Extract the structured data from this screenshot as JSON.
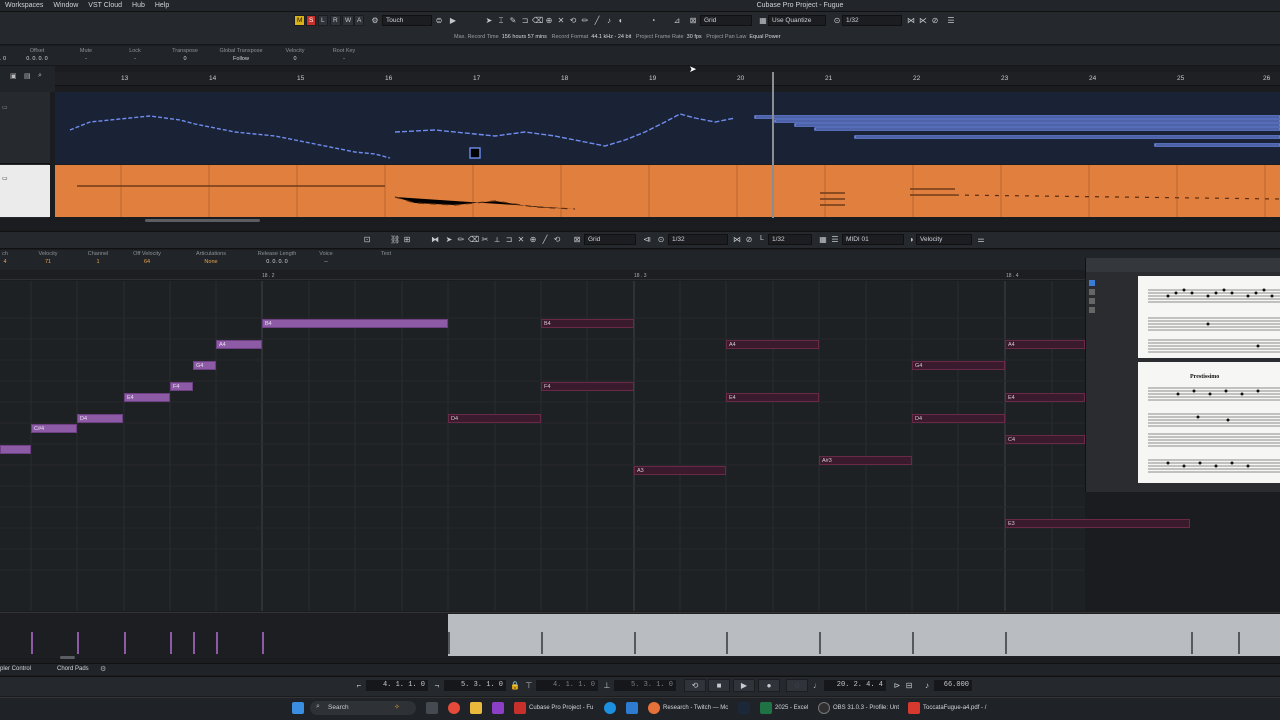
{
  "menu": [
    "Workspaces",
    "Window",
    "VST Cloud",
    "Hub",
    "Help"
  ],
  "window_title": "Cubase Pro Project - Fugue",
  "toolbar": {
    "state_buttons": [
      "M",
      "S",
      "L",
      "R",
      "W",
      "A"
    ],
    "automation_mode": "Touch",
    "snap_type": "Grid",
    "quantize_mode": "Use Quantize",
    "quantize_value": "1/32"
  },
  "status": {
    "max_record_time_label": "Max. Record Time",
    "max_record_time": "156 hours 57 mins",
    "record_format_label": "Record Format",
    "record_format": "44.1 kHz - 24 bit",
    "frame_rate_label": "Project Frame Rate",
    "frame_rate": "30 fps",
    "pan_law_label": "Project Pan Law",
    "pan_law": "Equal Power"
  },
  "infoline": [
    {
      "label": "Offset",
      "value": "0. 0. 0. 0"
    },
    {
      "label": "Mute",
      "value": "-"
    },
    {
      "label": "Lock",
      "value": "-"
    },
    {
      "label": "Transpose",
      "value": "0"
    },
    {
      "label": "Global Transpose",
      "value": "Follow"
    },
    {
      "label": "Velocity",
      "value": "0"
    },
    {
      "label": "Root Key",
      "value": "-"
    }
  ],
  "infoline_leading": ". 0",
  "ruler_bars": [
    "13",
    "14",
    "15",
    "16",
    "17",
    "18",
    "19",
    "20",
    "21",
    "22",
    "23",
    "24",
    "25",
    "26"
  ],
  "editor_toolbar": {
    "snap_type": "Grid",
    "quantize_value": "1/32",
    "length_label": "L",
    "length_value": "1/32",
    "midi_channel": "MIDI 01",
    "controller": "Velocity"
  },
  "editor_info": [
    {
      "label": "ch",
      "value": "4"
    },
    {
      "label": "Velocity",
      "value": "71"
    },
    {
      "label": "Channel",
      "value": "1"
    },
    {
      "label": "Off Velocity",
      "value": "64"
    },
    {
      "label": "Articulations",
      "value": "None"
    },
    {
      "label": "Release Length",
      "value": "0. 0. 0. 0"
    },
    {
      "label": "Voice",
      "value": "--"
    },
    {
      "label": "Text",
      "value": ""
    }
  ],
  "editor_ruler": [
    "18 . 2",
    "18 . 3",
    "18 . 4"
  ],
  "notes": [
    {
      "name": "",
      "sel": true
    },
    {
      "name": "C#4",
      "sel": true
    },
    {
      "name": "D4",
      "sel": true
    },
    {
      "name": "E4",
      "sel": true
    },
    {
      "name": "F4",
      "sel": true
    },
    {
      "name": "G4",
      "sel": true
    },
    {
      "name": "A4",
      "sel": true
    },
    {
      "name": "B4",
      "sel": true
    },
    {
      "name": "D4",
      "sel": false
    },
    {
      "name": "B4",
      "sel": false
    },
    {
      "name": "F4",
      "sel": false
    },
    {
      "name": "A3",
      "sel": false
    },
    {
      "name": "A4",
      "sel": false
    },
    {
      "name": "E4",
      "sel": false
    },
    {
      "name": "A#3",
      "sel": false
    },
    {
      "name": "G4",
      "sel": false
    },
    {
      "name": "D4",
      "sel": false
    },
    {
      "name": "A4",
      "sel": false
    },
    {
      "name": "E4",
      "sel": false
    },
    {
      "name": "C4",
      "sel": false
    },
    {
      "name": "E3",
      "sel": false
    }
  ],
  "score_tempo_text": "Prestissimo",
  "bottom_tabs": [
    "pler Control",
    "Chord Pads"
  ],
  "transport": {
    "left_locator": "4. 1. 1. 0",
    "right_locator": "5. 3. 1. 0",
    "punch_in": "4. 1. 1. 0",
    "punch_out": "5. 3. 1. 0",
    "position": "20. 2. 4. 4",
    "tempo": "66.000"
  },
  "taskbar": {
    "search_placeholder": "Search",
    "items": [
      "Cubase Pro Project - Fu",
      "Research - Twitch — Mc",
      "2025 - Excel",
      "OBS 31.0.3 - Profile: Unt",
      "ToccataFugue-a4.pdf - /"
    ]
  }
}
